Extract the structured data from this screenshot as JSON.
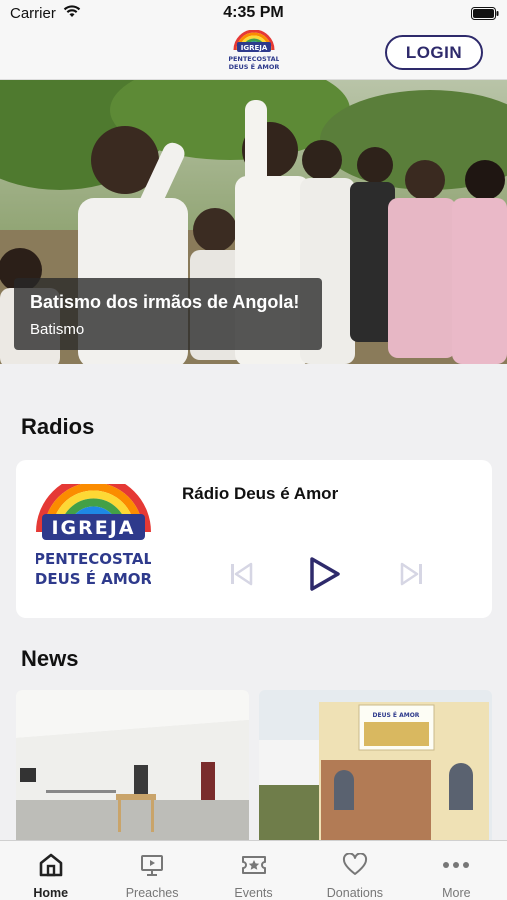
{
  "status_bar": {
    "carrier": "Carrier",
    "time": "4:35 PM"
  },
  "header": {
    "logo_lines": [
      "IGREJA",
      "PENTECOSTAL",
      "DEUS É AMOR"
    ],
    "login_label": "LOGIN"
  },
  "hero": {
    "title": "Batismo dos irmãos de Angola!",
    "category": "Batismo"
  },
  "radios": {
    "section_title": "Radios",
    "station_name": "Rádio Deus é Amor",
    "logo_lines": [
      "IGREJA",
      "PENTECOSTAL",
      "DEUS É AMOR"
    ]
  },
  "news": {
    "section_title": "News",
    "banner_text": "DEUS É AMOR"
  },
  "tabs": [
    {
      "label": "Home",
      "icon": "home-icon",
      "active": true
    },
    {
      "label": "Preaches",
      "icon": "presentation-icon",
      "active": false
    },
    {
      "label": "Events",
      "icon": "ticket-star-icon",
      "active": false
    },
    {
      "label": "Donations",
      "icon": "heart-icon",
      "active": false
    },
    {
      "label": "More",
      "icon": "more-dots-icon",
      "active": false
    }
  ],
  "colors": {
    "brand": "#2e2a6b",
    "background": "#f0f0f2",
    "card": "#ffffff"
  }
}
